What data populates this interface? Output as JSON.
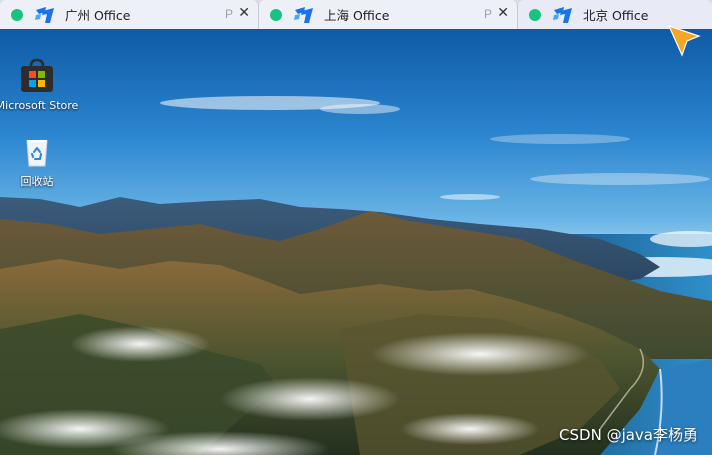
{
  "tabs": [
    {
      "title": "广州 Office",
      "pin_label": "P",
      "close_label": "✕",
      "status_color": "#19c37d"
    },
    {
      "title": "上海 Office",
      "pin_label": "P",
      "close_label": "✕",
      "status_color": "#19c37d"
    },
    {
      "title": "北京 Office",
      "status_color": "#19c37d"
    }
  ],
  "desktop": {
    "icons": [
      {
        "label": "Microsoft Store",
        "icon": "microsoft-store-icon"
      },
      {
        "label": "回收站",
        "icon": "recycle-bin-icon"
      }
    ],
    "wallpaper": "mountain-coast-landscape"
  },
  "watermark": "CSDN @java李杨勇",
  "colors": {
    "status_dot": "#19c37d",
    "logo_blue": "#1a73e8",
    "cursor": "#f5a623",
    "tabbar_bg": "#eef0f8"
  }
}
